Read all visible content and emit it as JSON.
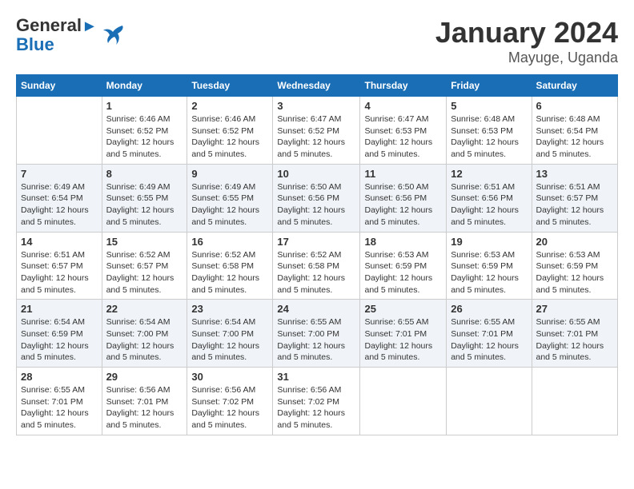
{
  "header": {
    "logo_general": "General",
    "logo_blue": "Blue",
    "title": "January 2024",
    "subtitle": "Mayuge, Uganda"
  },
  "days_of_week": [
    "Sunday",
    "Monday",
    "Tuesday",
    "Wednesday",
    "Thursday",
    "Friday",
    "Saturday"
  ],
  "weeks": [
    [
      {
        "day": "",
        "sunrise": "",
        "sunset": "",
        "daylight": ""
      },
      {
        "day": "1",
        "sunrise": "Sunrise: 6:46 AM",
        "sunset": "Sunset: 6:52 PM",
        "daylight": "Daylight: 12 hours and 5 minutes."
      },
      {
        "day": "2",
        "sunrise": "Sunrise: 6:46 AM",
        "sunset": "Sunset: 6:52 PM",
        "daylight": "Daylight: 12 hours and 5 minutes."
      },
      {
        "day": "3",
        "sunrise": "Sunrise: 6:47 AM",
        "sunset": "Sunset: 6:52 PM",
        "daylight": "Daylight: 12 hours and 5 minutes."
      },
      {
        "day": "4",
        "sunrise": "Sunrise: 6:47 AM",
        "sunset": "Sunset: 6:53 PM",
        "daylight": "Daylight: 12 hours and 5 minutes."
      },
      {
        "day": "5",
        "sunrise": "Sunrise: 6:48 AM",
        "sunset": "Sunset: 6:53 PM",
        "daylight": "Daylight: 12 hours and 5 minutes."
      },
      {
        "day": "6",
        "sunrise": "Sunrise: 6:48 AM",
        "sunset": "Sunset: 6:54 PM",
        "daylight": "Daylight: 12 hours and 5 minutes."
      }
    ],
    [
      {
        "day": "7",
        "sunrise": "Sunrise: 6:49 AM",
        "sunset": "Sunset: 6:54 PM",
        "daylight": "Daylight: 12 hours and 5 minutes."
      },
      {
        "day": "8",
        "sunrise": "Sunrise: 6:49 AM",
        "sunset": "Sunset: 6:55 PM",
        "daylight": "Daylight: 12 hours and 5 minutes."
      },
      {
        "day": "9",
        "sunrise": "Sunrise: 6:49 AM",
        "sunset": "Sunset: 6:55 PM",
        "daylight": "Daylight: 12 hours and 5 minutes."
      },
      {
        "day": "10",
        "sunrise": "Sunrise: 6:50 AM",
        "sunset": "Sunset: 6:56 PM",
        "daylight": "Daylight: 12 hours and 5 minutes."
      },
      {
        "day": "11",
        "sunrise": "Sunrise: 6:50 AM",
        "sunset": "Sunset: 6:56 PM",
        "daylight": "Daylight: 12 hours and 5 minutes."
      },
      {
        "day": "12",
        "sunrise": "Sunrise: 6:51 AM",
        "sunset": "Sunset: 6:56 PM",
        "daylight": "Daylight: 12 hours and 5 minutes."
      },
      {
        "day": "13",
        "sunrise": "Sunrise: 6:51 AM",
        "sunset": "Sunset: 6:57 PM",
        "daylight": "Daylight: 12 hours and 5 minutes."
      }
    ],
    [
      {
        "day": "14",
        "sunrise": "Sunrise: 6:51 AM",
        "sunset": "Sunset: 6:57 PM",
        "daylight": "Daylight: 12 hours and 5 minutes."
      },
      {
        "day": "15",
        "sunrise": "Sunrise: 6:52 AM",
        "sunset": "Sunset: 6:57 PM",
        "daylight": "Daylight: 12 hours and 5 minutes."
      },
      {
        "day": "16",
        "sunrise": "Sunrise: 6:52 AM",
        "sunset": "Sunset: 6:58 PM",
        "daylight": "Daylight: 12 hours and 5 minutes."
      },
      {
        "day": "17",
        "sunrise": "Sunrise: 6:52 AM",
        "sunset": "Sunset: 6:58 PM",
        "daylight": "Daylight: 12 hours and 5 minutes."
      },
      {
        "day": "18",
        "sunrise": "Sunrise: 6:53 AM",
        "sunset": "Sunset: 6:59 PM",
        "daylight": "Daylight: 12 hours and 5 minutes."
      },
      {
        "day": "19",
        "sunrise": "Sunrise: 6:53 AM",
        "sunset": "Sunset: 6:59 PM",
        "daylight": "Daylight: 12 hours and 5 minutes."
      },
      {
        "day": "20",
        "sunrise": "Sunrise: 6:53 AM",
        "sunset": "Sunset: 6:59 PM",
        "daylight": "Daylight: 12 hours and 5 minutes."
      }
    ],
    [
      {
        "day": "21",
        "sunrise": "Sunrise: 6:54 AM",
        "sunset": "Sunset: 6:59 PM",
        "daylight": "Daylight: 12 hours and 5 minutes."
      },
      {
        "day": "22",
        "sunrise": "Sunrise: 6:54 AM",
        "sunset": "Sunset: 7:00 PM",
        "daylight": "Daylight: 12 hours and 5 minutes."
      },
      {
        "day": "23",
        "sunrise": "Sunrise: 6:54 AM",
        "sunset": "Sunset: 7:00 PM",
        "daylight": "Daylight: 12 hours and 5 minutes."
      },
      {
        "day": "24",
        "sunrise": "Sunrise: 6:55 AM",
        "sunset": "Sunset: 7:00 PM",
        "daylight": "Daylight: 12 hours and 5 minutes."
      },
      {
        "day": "25",
        "sunrise": "Sunrise: 6:55 AM",
        "sunset": "Sunset: 7:01 PM",
        "daylight": "Daylight: 12 hours and 5 minutes."
      },
      {
        "day": "26",
        "sunrise": "Sunrise: 6:55 AM",
        "sunset": "Sunset: 7:01 PM",
        "daylight": "Daylight: 12 hours and 5 minutes."
      },
      {
        "day": "27",
        "sunrise": "Sunrise: 6:55 AM",
        "sunset": "Sunset: 7:01 PM",
        "daylight": "Daylight: 12 hours and 5 minutes."
      }
    ],
    [
      {
        "day": "28",
        "sunrise": "Sunrise: 6:55 AM",
        "sunset": "Sunset: 7:01 PM",
        "daylight": "Daylight: 12 hours and 5 minutes."
      },
      {
        "day": "29",
        "sunrise": "Sunrise: 6:56 AM",
        "sunset": "Sunset: 7:01 PM",
        "daylight": "Daylight: 12 hours and 5 minutes."
      },
      {
        "day": "30",
        "sunrise": "Sunrise: 6:56 AM",
        "sunset": "Sunset: 7:02 PM",
        "daylight": "Daylight: 12 hours and 5 minutes."
      },
      {
        "day": "31",
        "sunrise": "Sunrise: 6:56 AM",
        "sunset": "Sunset: 7:02 PM",
        "daylight": "Daylight: 12 hours and 5 minutes."
      },
      {
        "day": "",
        "sunrise": "",
        "sunset": "",
        "daylight": ""
      },
      {
        "day": "",
        "sunrise": "",
        "sunset": "",
        "daylight": ""
      },
      {
        "day": "",
        "sunrise": "",
        "sunset": "",
        "daylight": ""
      }
    ]
  ]
}
